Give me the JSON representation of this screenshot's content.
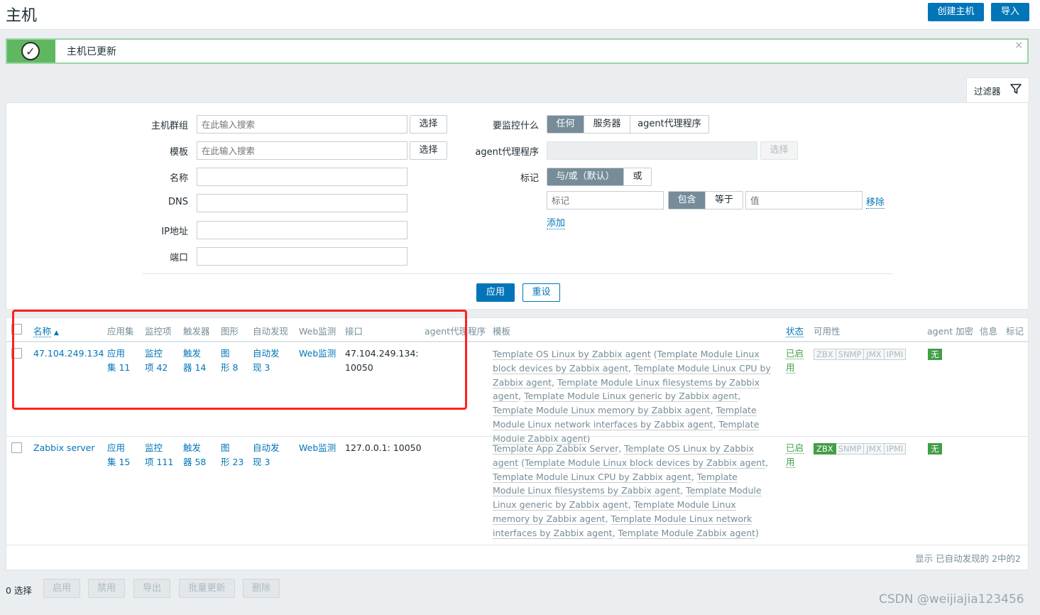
{
  "header": {
    "title": "主机",
    "create_label": "创建主机",
    "import_label": "导入"
  },
  "message": {
    "text": "主机已更新",
    "close": "×"
  },
  "filter": {
    "tab_label": "过滤器",
    "host_groups": {
      "label": "主机群组",
      "placeholder": "在此输入搜索",
      "select": "选择"
    },
    "templates": {
      "label": "模板",
      "placeholder": "在此输入搜索",
      "select": "选择"
    },
    "name_label": "名称",
    "dns_label": "DNS",
    "ip_label": "IP地址",
    "port_label": "端口",
    "monitored_by": {
      "label": "要监控什么",
      "options": [
        "任何",
        "服务器",
        "agent代理程序"
      ]
    },
    "proxy": {
      "label": "agent代理程序",
      "select": "选择"
    },
    "tags": {
      "label": "标记",
      "mode_options": [
        "与/或（默认）",
        "或"
      ],
      "tag_placeholder": "标记",
      "op_options": [
        "包含",
        "等于"
      ],
      "value_placeholder": "值",
      "remove": "移除",
      "add": "添加"
    },
    "apply": "应用",
    "reset": "重设"
  },
  "table": {
    "headers": {
      "name": "名称",
      "sort_arrow": "▲",
      "apps": "应用集",
      "items": "监控项",
      "triggers": "触发器",
      "graphs": "图形",
      "discovery": "自动发现",
      "web": "Web监测",
      "interface": "接口",
      "proxy": "agent代理程序",
      "templates": "模板",
      "status": "状态",
      "availability": "可用性",
      "encryption": "agent 加密",
      "info": "信息",
      "tags": "标记"
    },
    "rows": [
      {
        "name": "47.104.249.134",
        "apps": [
          "应用",
          "集 11"
        ],
        "items": [
          "监控",
          "项 42"
        ],
        "triggers": [
          "触发",
          "器 14"
        ],
        "graphs": [
          "图",
          "形 8"
        ],
        "discovery": [
          "自动发",
          "现 3"
        ],
        "web": "Web监测",
        "interface": [
          "47.104.249.134:",
          "10050"
        ],
        "templates": [
          "Template OS Linux by Zabbix agent",
          "Template Module Linux block devices by Zabbix agent",
          "Template Module Linux CPU by Zabbix agent",
          "Template Module Linux filesystems by Zabbix agent",
          "Template Module Linux generic by Zabbix agent",
          "Template Module Linux memory by Zabbix agent",
          "Template Module Linux network interfaces by Zabbix agent",
          "Template Module Zabbix agent"
        ],
        "status": [
          "已启",
          "用"
        ],
        "availability": [
          "ZBX",
          "SNMP",
          "JMX",
          "IPMI"
        ],
        "zbx_active": false,
        "encryption": "无"
      },
      {
        "name": "Zabbix server",
        "apps": [
          "应用",
          "集 15"
        ],
        "items": [
          "监控",
          "项 111"
        ],
        "triggers": [
          "触发",
          "器 58"
        ],
        "graphs": [
          "图",
          "形 23"
        ],
        "discovery": [
          "自动发",
          "现 3"
        ],
        "web": "Web监测",
        "interface": [
          "127.0.0.1: 10050"
        ],
        "templates": [
          "Template App Zabbix Server",
          "Template OS Linux by Zabbix agent",
          "Template Module Linux block devices by Zabbix agent",
          "Template Module Linux CPU by Zabbix agent",
          "Template Module Linux filesystems by Zabbix agent",
          "Template Module Linux generic by Zabbix agent",
          "Template Module Linux memory by Zabbix agent",
          "Template Module Linux network interfaces by Zabbix agent",
          "Template Module Zabbix agent"
        ],
        "status": [
          "已启",
          "用"
        ],
        "availability": [
          "ZBX",
          "SNMP",
          "JMX",
          "IPMI"
        ],
        "zbx_active": true,
        "encryption": "无"
      }
    ],
    "footer": "显示 已自动发现的 2中的2"
  },
  "actions": {
    "selected": "0 选择",
    "buttons": [
      "启用",
      "禁用",
      "导出",
      "批量更新",
      "删除"
    ]
  },
  "watermark": "CSDN @weijiajia123456",
  "colors": {
    "primary": "#0275b8",
    "success": "#429e47",
    "annotation": "#ff2020"
  }
}
